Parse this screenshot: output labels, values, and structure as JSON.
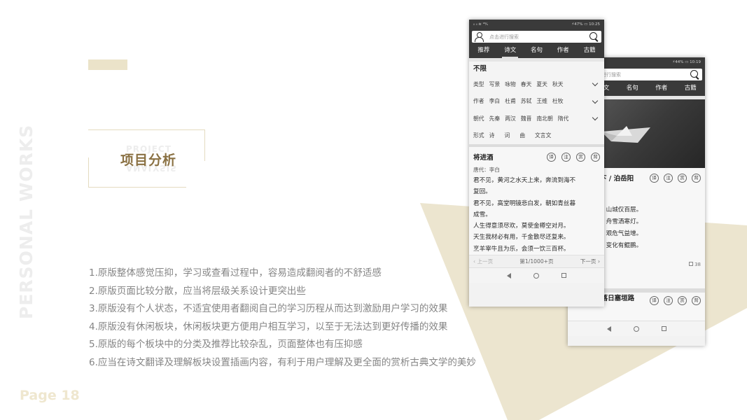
{
  "side_title": "PERSONAL WORKS",
  "page_label": "Page 18",
  "section": {
    "title": "项目分析",
    "ghost_top": "PROJECT",
    "ghost_bottom": "ANALYSIS"
  },
  "bullets": [
    "1.原版整体感觉压抑，学习或查看过程中，容易造成翻阅者的不舒适感",
    "2.原版页面比较分散，应当将层级关系设计更突出些",
    "3.原版没有个人状态，不适宜使用者翻阅自己的学习历程从而达到激励用户学习的效果",
    "4.原版没有休闲板块，休闲板块更方便用户相互学习，以至于无法达到更好传播的效果",
    "5.原版的每个板块中的分类及推荐比较杂乱，页面整体也有压抑感",
    "6.应当在诗文翻译及理解板块设置插画内容，有利于用户理解及更全面的赏析古典文学的美妙"
  ],
  "colors": {
    "accent": "#ebe3c9",
    "title_brown": "#8a7143",
    "triangle": "#ece5cf"
  },
  "phone_front": {
    "status_left": "ᵢₗ ᵢₗ ≋ ⁹⁶⁄ₛ",
    "status_right": "⚡47% ▭ 10:25",
    "search_placeholder": "点击进行搜索",
    "tabs": [
      "推荐",
      "诗文",
      "名句",
      "作者",
      "古籍"
    ],
    "active_tab": "诗文",
    "filter_head": "不限",
    "filters": [
      {
        "key": "类型",
        "values": [
          "写景",
          "咏物",
          "春天",
          "夏天",
          "秋天"
        ],
        "chevron": true
      },
      {
        "key": "作者",
        "values": [
          "李白",
          "杜甫",
          "苏轼",
          "王维",
          "杜牧"
        ],
        "chevron": true
      },
      {
        "key": "朝代",
        "values": [
          "先秦",
          "两汉",
          "魏晋",
          "南北朝",
          "隋代"
        ],
        "chevron": true
      },
      {
        "key": "形式",
        "values": [
          "诗",
          "词",
          "曲",
          "文言文"
        ],
        "chevron": false
      }
    ],
    "poem_title": "将进酒",
    "stamps": [
      "译",
      "注",
      "赏",
      "背"
    ],
    "dynasty": "唐代：李白",
    "poem_lines": [
      "君不见，黄河之水天上来，奔流到海不",
      "复回。",
      "君不见，高堂明镜悲白发，朝如青丝暮",
      "成雪。",
      "人生得意须尽欢，莫使金樽空对月。",
      "天生我材必有用，千金散尽还复来。",
      "烹羊宰牛且为乐，会须一饮三百杯。"
    ],
    "pager": {
      "prev": "上一页",
      "info": "第1/1000+页",
      "next": "下一页"
    }
  },
  "phone_back": {
    "status_right": "⚡44% ▭ 10:19",
    "search_placeholder": "进行搜索",
    "tabs": [
      "诗文",
      "名句",
      "作者",
      "古籍"
    ],
    "poem_title": "下 / 泊岳阳",
    "stamps": [
      "译",
      "注",
      "赏",
      "背"
    ],
    "poem_lines": [
      "，山城仅百层。",
      "，舟雪洒寒灯。",
      "，艰危气益增。",
      "，变化有鲲鹏。"
    ],
    "likes": "38",
    "card2_title": "水调歌头·落日塞垣路",
    "card2_stamps": [
      "译",
      "注",
      "赏",
      "背"
    ]
  }
}
